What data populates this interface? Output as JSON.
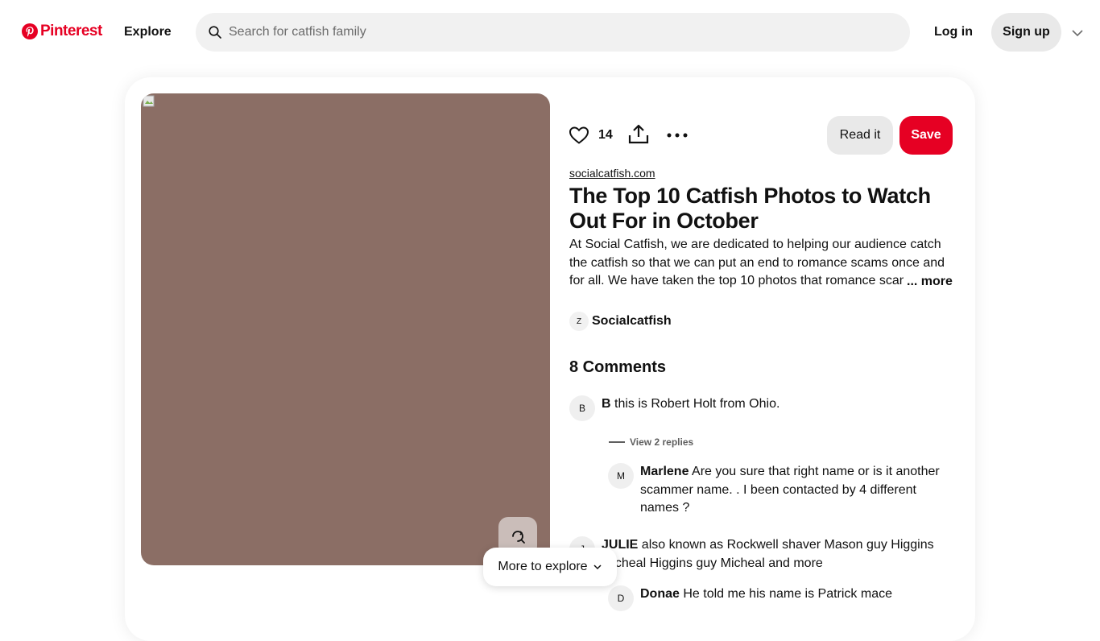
{
  "header": {
    "logo_text": "Pinterest",
    "explore_label": "Explore",
    "search_placeholder": "Search for catfish family",
    "login_label": "Log in",
    "signup_label": "Sign up",
    "brand_color": "#e60023"
  },
  "pin": {
    "image_color": "#8b6e65",
    "reaction_count": "14",
    "read_label": "Read it",
    "save_label": "Save",
    "source": "socialcatfish.com",
    "title": "The Top 10 Catfish Photos to Watch Out For in October",
    "description": "At Social Catfish, we are dedicated to helping our audience catch the catfish so that we can put an end to romance scams once and for all. We have taken the top 10 photos that romance scammers use",
    "more_label": "... more",
    "author_initial": "Z",
    "author_name": "Socialcatfish",
    "more_to_explore": "More to explore"
  },
  "comments": {
    "heading": "8 Comments",
    "view_replies": "View 2 replies",
    "items": [
      {
        "initial": "B",
        "author": "B",
        "text": " this is Robert Holt from Ohio."
      },
      {
        "initial": "M",
        "author": "Marlene",
        "text": " Are you sure that right name or is it another scammer name. . I been contacted by 4 different names ?"
      },
      {
        "initial": "J",
        "author": "JULIE",
        "text": " also known as Rockwell shaver Mason guy Higgins Micheal Higgins guy Micheal and more"
      },
      {
        "initial": "D",
        "author": "Donae",
        "text": " He told me his name is Patrick mace"
      }
    ]
  },
  "icons": [
    "pinterest-logo-icon",
    "search-icon",
    "chevron-down-icon",
    "heart-icon",
    "share-icon",
    "more-dots-icon",
    "broken-image-icon",
    "visual-search-icon"
  ]
}
